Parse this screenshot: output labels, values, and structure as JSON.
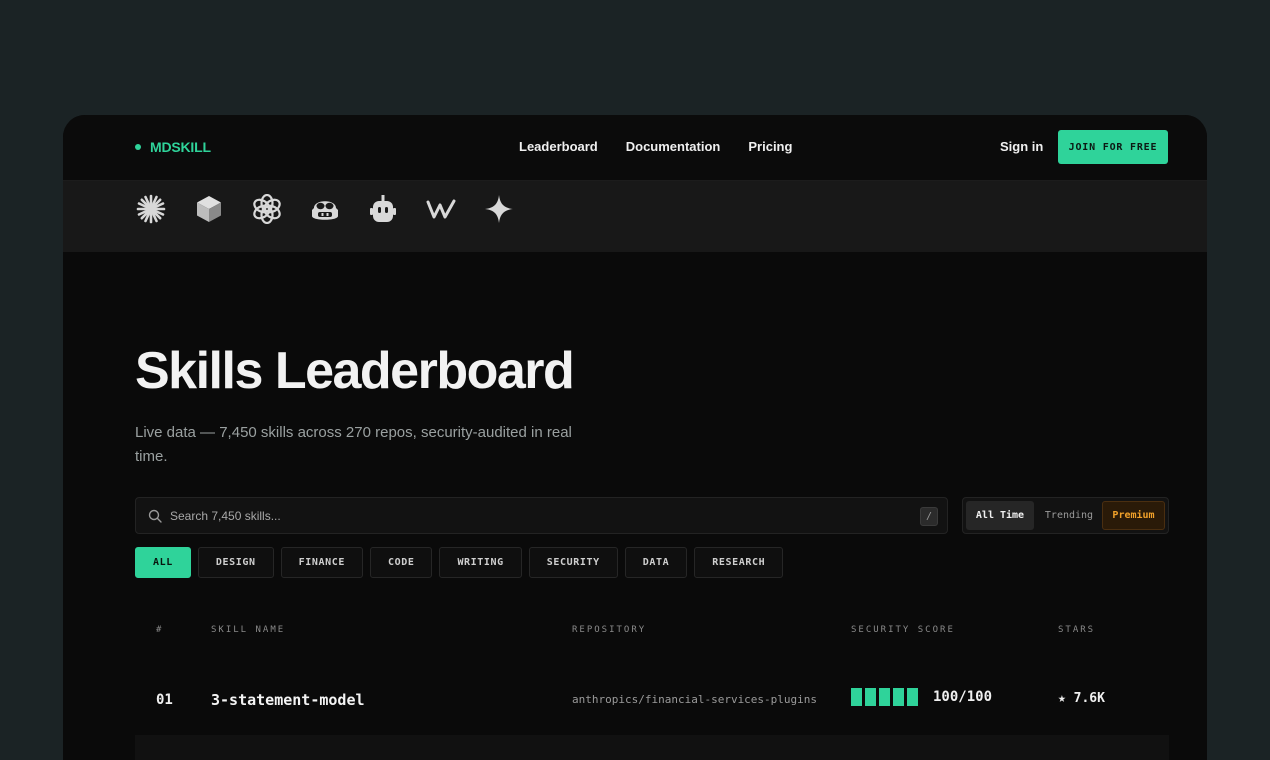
{
  "brand": {
    "name": "MDSKILL",
    "accent": "#2fd39a"
  },
  "nav": {
    "links": [
      "Leaderboard",
      "Documentation",
      "Pricing"
    ],
    "sign_in": "Sign in",
    "join": "JOIN FOR FREE"
  },
  "providers": [
    "claude-icon",
    "cube-icon",
    "openai-icon",
    "copilot-icon",
    "robot-icon",
    "windsurf-icon",
    "gemini-icon"
  ],
  "hero": {
    "title": "Skills Leaderboard",
    "subtitle": "Live data — 7,450 skills across 270 repos, security-audited in real time."
  },
  "search": {
    "placeholder": "Search 7,450 skills...",
    "shortcut": "/"
  },
  "time_filter": {
    "options": [
      "All Time",
      "Trending",
      "Premium"
    ],
    "selected": "All Time",
    "premium_color": "#f0a02a"
  },
  "categories": {
    "items": [
      "ALL",
      "DESIGN",
      "FINANCE",
      "CODE",
      "WRITING",
      "SECURITY",
      "DATA",
      "RESEARCH"
    ],
    "selected": "ALL"
  },
  "table": {
    "columns": [
      "#",
      "SKILL NAME",
      "REPOSITORY",
      "SECURITY SCORE",
      "STARS"
    ],
    "rows": [
      {
        "rank": "01",
        "name": "3-statement-model",
        "repo": "anthropics/financial-services-plugins",
        "score_fraction": 1.0,
        "score": "100/100",
        "stars": "★ 7.6K"
      }
    ]
  }
}
